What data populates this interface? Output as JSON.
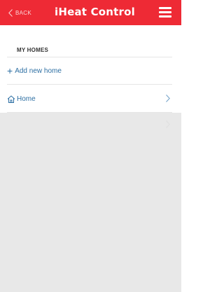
{
  "header": {
    "back_label": "BACK",
    "title": "iHeat Control",
    "background_color": "#ee2a35"
  },
  "my_homes": {
    "section_title": "MY HOMES",
    "add_label": "Add new home",
    "homes": [
      {
        "name": "Home"
      }
    ]
  },
  "icons": {
    "back": "chevron-left-icon",
    "menu": "hamburger-menu-icon",
    "add": "plus-icon",
    "home": "house-icon",
    "chevron": "chevron-right-icon"
  },
  "colors": {
    "accent": "#ee2a35",
    "link": "#2d6fa3",
    "empty_area": "#e8e8e8"
  }
}
